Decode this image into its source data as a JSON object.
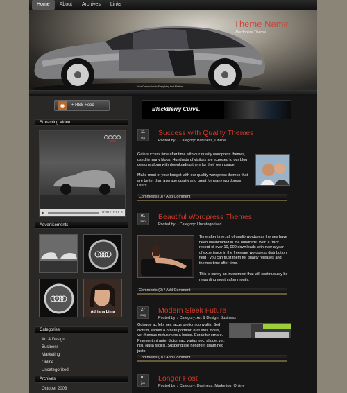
{
  "nav": {
    "items": [
      "Home",
      "About",
      "Archives",
      "Links"
    ],
    "active": "Home"
  },
  "header": {
    "site_title": "Theme Name",
    "tagline": "Wordpress Theme",
    "car_caption": "Your Connection to Everything that Matters"
  },
  "sidebar": {
    "rss_label": "+ RSS Feed",
    "video_heading": "Streaming Video",
    "video_brand": "audi",
    "video_time": "0:00 / 0:00",
    "ads_heading": "Advertisements",
    "ad_caption": "Adriana Lima",
    "categories_heading": "Categories",
    "categories": [
      "Art & Design",
      "Business",
      "Marketing",
      "Online",
      "Uncategorized"
    ],
    "archives_heading": "Archives",
    "archives": [
      "October 2008"
    ]
  },
  "main": {
    "banner_text": "BlackBerry Curve.",
    "posts": [
      {
        "day": "11",
        "month": "oct",
        "title": "Success with Quality Themes",
        "meta": "Posted by:  /  Category: Business, Online",
        "paragraphs": [
          "Gain success time after time with our quality wordpress themes, used in many blogs. Hundreds of visitors are exposed to our blog designs along with downloading them for their own usage.",
          "Make most of your budget with our quality wordpress themes that are better than average quality and great for many wordpress users."
        ],
        "footer_comments": "Comments (0)",
        "footer_add": "Add Comment"
      },
      {
        "day": "01",
        "month": "sep",
        "title": "Beautiful Wordpress Themes",
        "meta": "Posted by:  /  Category: Uncategorized",
        "paragraphs": [
          "Time after time, all of qualitywordpress themes have been downloaded in the hundreds. With a track record of over 10, 000 downloads with over a year of experience in the freeware wordpress distribution field - you can trust them for quality releases and themes time after time.",
          "This is surely an investment that will continuously be rewarding month after month."
        ],
        "footer_comments": "Comments (0)",
        "footer_add": "Add Comment"
      },
      {
        "day": "27",
        "month": "aug",
        "title": "Modern Sleek Future",
        "meta": "Posted by:  /  Category: Art & Design, Business",
        "paragraphs": [
          "Quisque ac felis nec lacus pretium convallis. Sed dictum, sapien a ornare porttitor, erat eros mollis, vel rhoncus metus nunc a lectus. Curabitur ornare. Praesent mi ante, dictum ac, varius nec, aliquet vel, nisl. Nulla facilisi. Suspendisse hendrerit quam nec justo."
        ],
        "footer_comments": "Comments (0)",
        "footer_add": "Add Comment"
      },
      {
        "day": "01",
        "month": "jun",
        "title": "Longer Post",
        "meta": "Posted by:  /  Category: Business, Marketing, Online",
        "paragraphs": [],
        "footer_comments": "",
        "footer_add": ""
      }
    ]
  },
  "colors": {
    "accent": "#d23a2a",
    "background": "#8b8577",
    "page": "#1b1b1b"
  }
}
